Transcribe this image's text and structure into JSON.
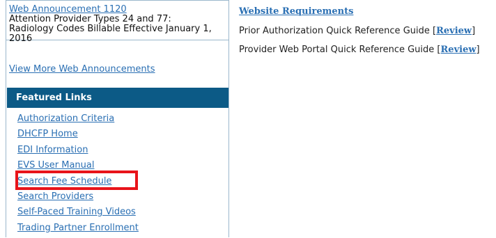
{
  "announcement": {
    "link": "Web Announcement 1120",
    "text": "Attention Provider Types 24 and 77: Radiology Codes Billable Effective January 1, 2016",
    "view_more": "View More Web Announcements"
  },
  "featured": {
    "title": "Featured Links",
    "links": [
      "Authorization Criteria",
      "DHCFP Home",
      "EDI Information",
      "EVS User Manual",
      "Search Fee Schedule",
      "Search Providers",
      "Self-Paced Training Videos",
      "Trading Partner Enrollment"
    ],
    "highlight_color": "#e8141a"
  },
  "requirements": {
    "title": "Website Requirements",
    "items": [
      {
        "label": "Prior Authorization Quick Reference Guide",
        "link": "Review"
      },
      {
        "label": "Provider Web Portal Quick Reference Guide",
        "link": "Review"
      }
    ]
  },
  "colors": {
    "header_bg": "#0c5a86",
    "link": "#2a6fb3",
    "border": "#9bb7cc"
  }
}
